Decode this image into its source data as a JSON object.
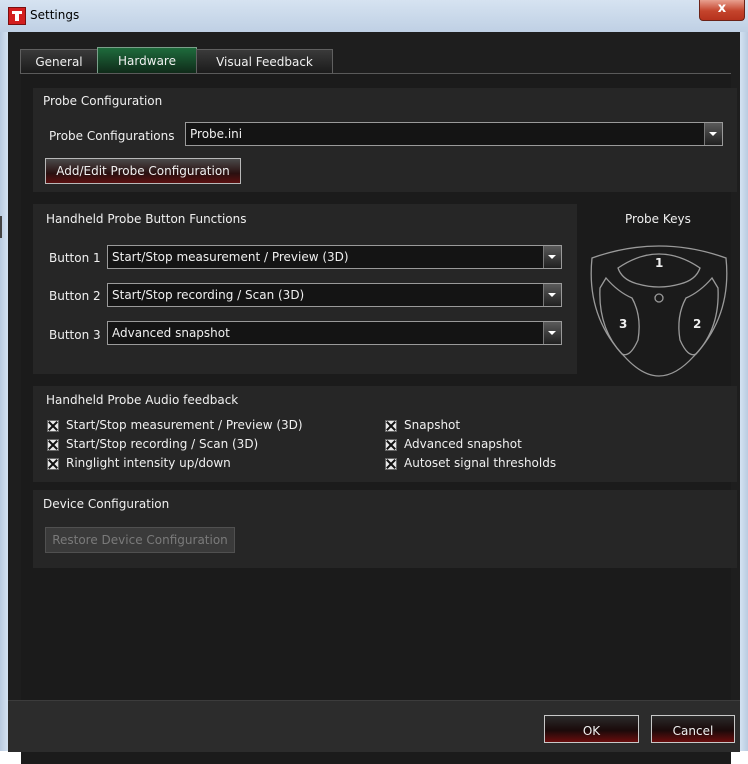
{
  "window": {
    "title": "Settings",
    "close_label": "x"
  },
  "tabs": [
    {
      "label": "General"
    },
    {
      "label": "Hardware"
    },
    {
      "label": "Visual Feedback"
    }
  ],
  "probe_configuration": {
    "group_title": "Probe Configuration",
    "label": "Probe Configurations",
    "value": "Probe.ini",
    "add_edit_button": "Add/Edit Probe Configuration"
  },
  "button_functions": {
    "group_title": "Handheld Probe Button Functions",
    "rows": [
      {
        "label": "Button 1",
        "value": "Start/Stop measurement / Preview (3D)"
      },
      {
        "label": "Button 2",
        "value": "Start/Stop recording / Scan (3D)"
      },
      {
        "label": "Button 3",
        "value": "Advanced snapshot"
      }
    ]
  },
  "probe_keys": {
    "title": "Probe Keys",
    "keys": [
      "1",
      "2",
      "3"
    ]
  },
  "audio_feedback": {
    "group_title": "Handheld Probe Audio feedback",
    "left": [
      {
        "label": "Start/Stop measurement / Preview (3D)",
        "checked": true
      },
      {
        "label": "Start/Stop recording / Scan (3D)",
        "checked": true
      },
      {
        "label": "Ringlight intensity up/down",
        "checked": true
      }
    ],
    "right": [
      {
        "label": "Snapshot",
        "checked": true
      },
      {
        "label": "Advanced snapshot",
        "checked": true
      },
      {
        "label": "Autoset signal thresholds",
        "checked": true
      }
    ]
  },
  "device_configuration": {
    "group_title": "Device Configuration",
    "restore_button": "Restore Device Configuration"
  },
  "footer": {
    "ok_label": "OK",
    "cancel_label": "Cancel"
  },
  "colors": {
    "accent_tab": "#1e6b3c",
    "button_red": "#6a0d0d",
    "panel_bg": "#262626"
  }
}
